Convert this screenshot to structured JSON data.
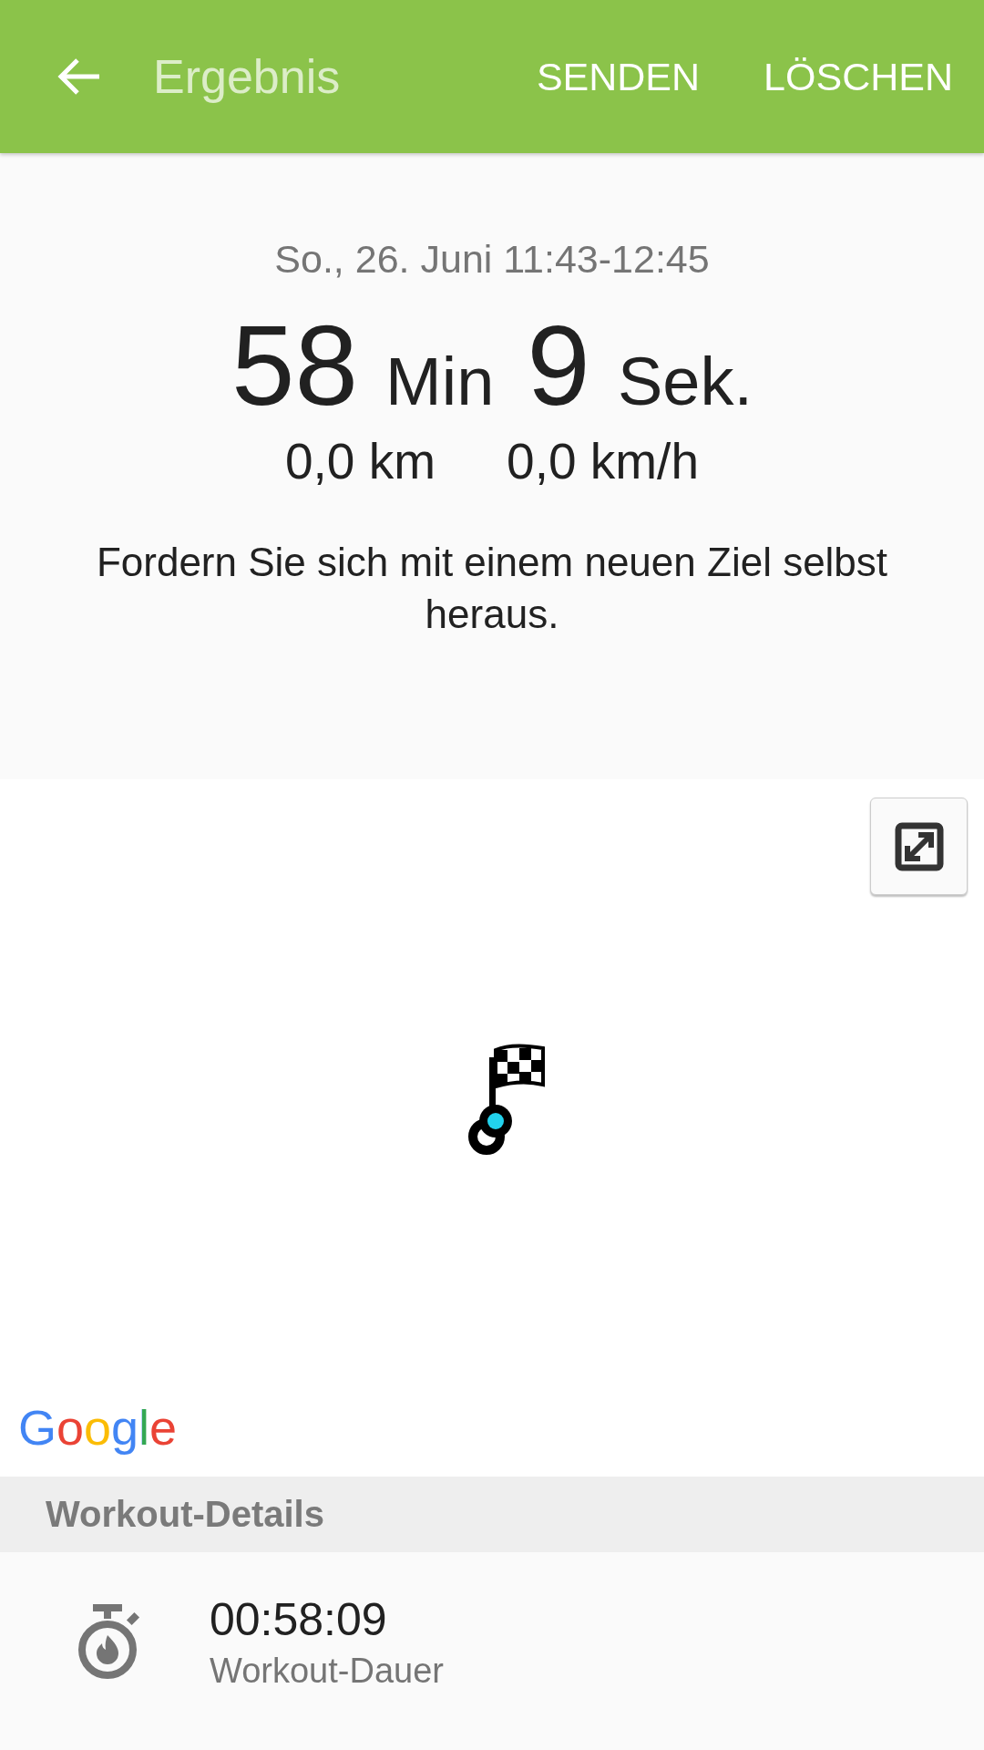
{
  "app_bar": {
    "title": "Ergebnis",
    "actions": [
      "SENDEN",
      "LÖSCHEN"
    ]
  },
  "summary": {
    "date": "So., 26. Juni 11:43-12:45",
    "duration": [
      {
        "kind": "number",
        "text": "58"
      },
      {
        "kind": "unit",
        "text": "Min"
      },
      {
        "kind": "number",
        "text": "9"
      },
      {
        "kind": "unit",
        "text": "Sek."
      }
    ],
    "stats": [
      "0,0 km",
      "0,0 km/h"
    ],
    "message": "Fordern Sie sich mit einem neuen Ziel selbst heraus."
  },
  "map": {
    "attribution": "Google"
  },
  "section_title": "Workout-Details",
  "details": [
    {
      "value": "00:58:09",
      "label": "Workout-Dauer"
    }
  ]
}
